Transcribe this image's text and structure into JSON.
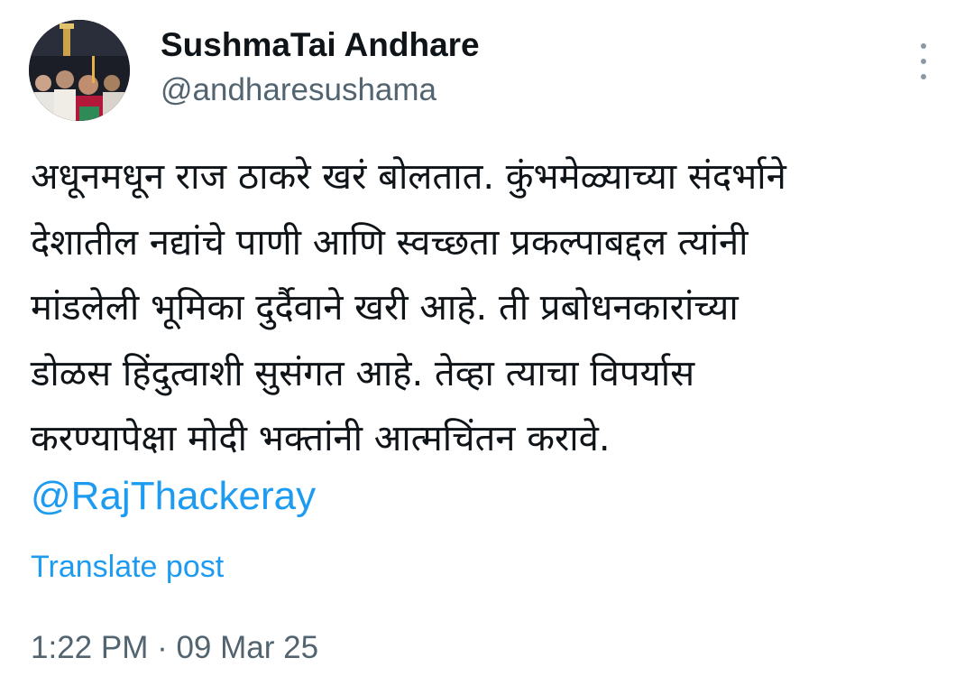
{
  "author": {
    "display_name": "SushmaTai Andhare",
    "handle": "@andharesushama",
    "avatar_icon": "profile-photo"
  },
  "menu": {
    "icon": "more-vertical-icon"
  },
  "post": {
    "lines": [
      "अधूनमधून राज ठाकरे खरं बोलतात. कुंभमेळ्याच्या संदर्भाने",
      "देशातील नद्यांचे पाणी आणि स्वच्छता प्रकल्पाबद्दल त्यांनी",
      "मांडलेली भूमिका दुर्दैवाने खरी आहे. ती प्रबोधनकारांच्या",
      "डोळस हिंदुत्वाशी सुसंगत आहे. तेव्हा त्याचा विपर्यास",
      "करण्यापेक्षा मोदी भक्तांनी आत्मचिंतन करावे."
    ],
    "mention": "@RajThackeray",
    "translate_label": "Translate post",
    "timestamp": "1:22 PM · 09 Mar 25"
  },
  "colors": {
    "link": "#1d9bf0",
    "secondary_text": "#536471",
    "primary_text": "#0f1419"
  }
}
